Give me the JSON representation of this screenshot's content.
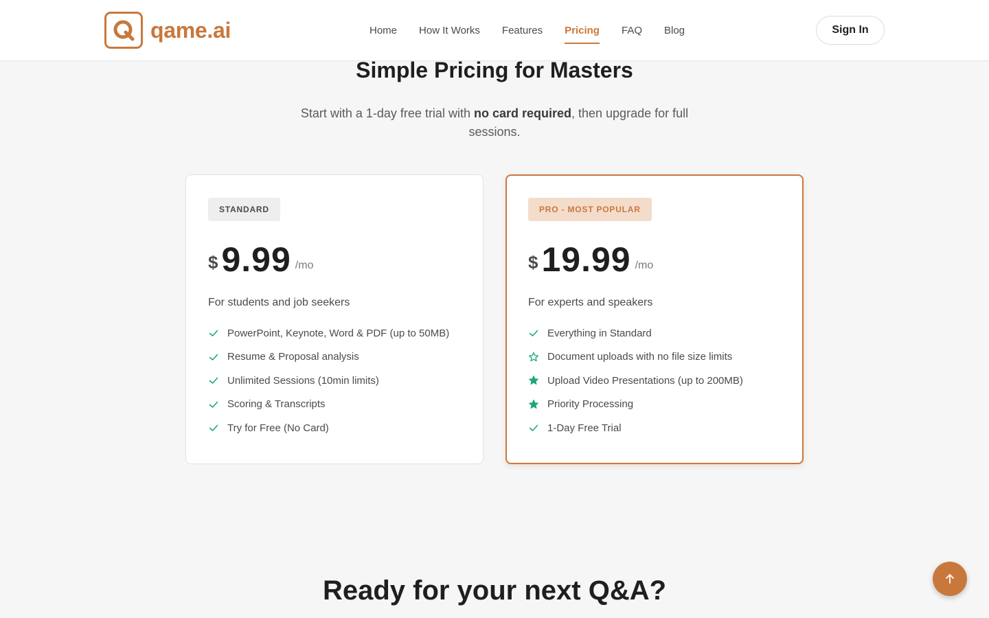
{
  "brand": {
    "name": "qame.ai",
    "logo_letter": "Q"
  },
  "nav": [
    {
      "label": "Home",
      "active": false
    },
    {
      "label": "How It Works",
      "active": false
    },
    {
      "label": "Features",
      "active": false
    },
    {
      "label": "Pricing",
      "active": true
    },
    {
      "label": "FAQ",
      "active": false
    },
    {
      "label": "Blog",
      "active": false
    }
  ],
  "signin_label": "Sign In",
  "hero": {
    "title": "Simple Pricing for Masters",
    "subtitle_pre": "Start with a 1-day free trial with ",
    "subtitle_bold": "no card required",
    "subtitle_post": ", then upgrade for full sessions."
  },
  "plans": [
    {
      "badge": "STANDARD",
      "currency": "$",
      "price": "9.99",
      "period": "/mo",
      "description": "For students and job seekers",
      "features": [
        {
          "text": "PowerPoint, Keynote, Word & PDF (up to 50MB)",
          "icon": "check-icon"
        },
        {
          "text": "Resume & Proposal analysis",
          "icon": "check-icon"
        },
        {
          "text": "Unlimited Sessions (10min limits)",
          "icon": "check-icon"
        },
        {
          "text": "Scoring & Transcripts",
          "icon": "check-icon"
        },
        {
          "text": "Try for Free (No Card)",
          "icon": "check-icon"
        }
      ]
    },
    {
      "badge": "PRO - MOST POPULAR",
      "currency": "$",
      "price": "19.99",
      "period": "/mo",
      "description": "For experts and speakers",
      "features": [
        {
          "text": "Everything in Standard",
          "icon": "check-icon"
        },
        {
          "text": "Document uploads with no file size limits",
          "icon": "star-outline-icon"
        },
        {
          "text": "Upload Video Presentations (up to 200MB)",
          "icon": "star-filled-icon"
        },
        {
          "text": "Priority Processing",
          "icon": "star-filled-icon"
        },
        {
          "text": "1-Day Free Trial",
          "icon": "check-icon"
        }
      ]
    }
  ],
  "cta_title": "Ready for your next Q&A?",
  "scroll_top_icon": "arrow-up-icon",
  "colors": {
    "accent": "#c9783c",
    "accent_light": "#f4dccb",
    "check": "#1fa67a"
  }
}
